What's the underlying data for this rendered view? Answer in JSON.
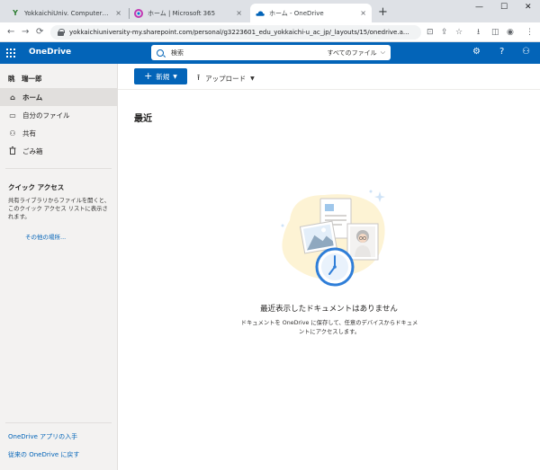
{
  "browser": {
    "tabs": [
      {
        "title": "YokkaichiUniv. ComputerCenter |",
        "close": "×"
      },
      {
        "title": "ホーム | Microsoft 365",
        "close": "×"
      },
      {
        "title": "ホーム - OneDrive",
        "close": "×"
      }
    ],
    "new_tab": "+",
    "window_controls": [
      "—",
      "☐",
      "✕"
    ],
    "nav": {
      "back": "←",
      "forward": "→",
      "reload": "⟳"
    },
    "url": "yokkaichiuniversity-my.sharepoint.com/personal/g3223601_edu_yokkaichi-u_ac_jp/_layouts/15/onedrive.a...",
    "toolbar_icons": [
      "⊡",
      "⇪",
      "☆",
      "⭳",
      "◫",
      "◉",
      "⋮"
    ]
  },
  "header": {
    "app_name": "OneDrive",
    "search_placeholder": "検索",
    "search_scope": "すべてのファイル",
    "icons": [
      "⚙",
      "?",
      "⚇"
    ]
  },
  "sidebar": {
    "user_name": "眺　瑞一郎",
    "items": [
      {
        "label": "ホーム",
        "icon": "home-icon",
        "glyph": "⌂",
        "selected": true
      },
      {
        "label": "自分のファイル",
        "icon": "folder-icon",
        "glyph": "▭",
        "selected": false
      },
      {
        "label": "共有",
        "icon": "people-icon",
        "glyph": "⚇",
        "selected": false
      },
      {
        "label": "ごみ箱",
        "icon": "trash-icon",
        "glyph": "🗑",
        "selected": false
      }
    ],
    "quick_access": {
      "title": "クイック アクセス",
      "description": "共有ライブラリからファイルを開くと、このクイック アクセス リストに表示されます。",
      "more_link": "その他の場所..."
    },
    "bottom_links": [
      "OneDrive アプリの入手",
      "従来の OneDrive に戻す"
    ]
  },
  "commandbar": {
    "new_label": "新規",
    "upload_label": "アップロード"
  },
  "main": {
    "title": "最近",
    "empty_title": "最近表示したドキュメントはありません",
    "empty_description": "ドキュメントを OneDrive に保存して、任意のデバイスからドキュメントにアクセスします。"
  },
  "colors": {
    "brand": "#0364b8",
    "nav_bg": "#f3f2f1",
    "selected_bg": "#e1dfdd"
  }
}
